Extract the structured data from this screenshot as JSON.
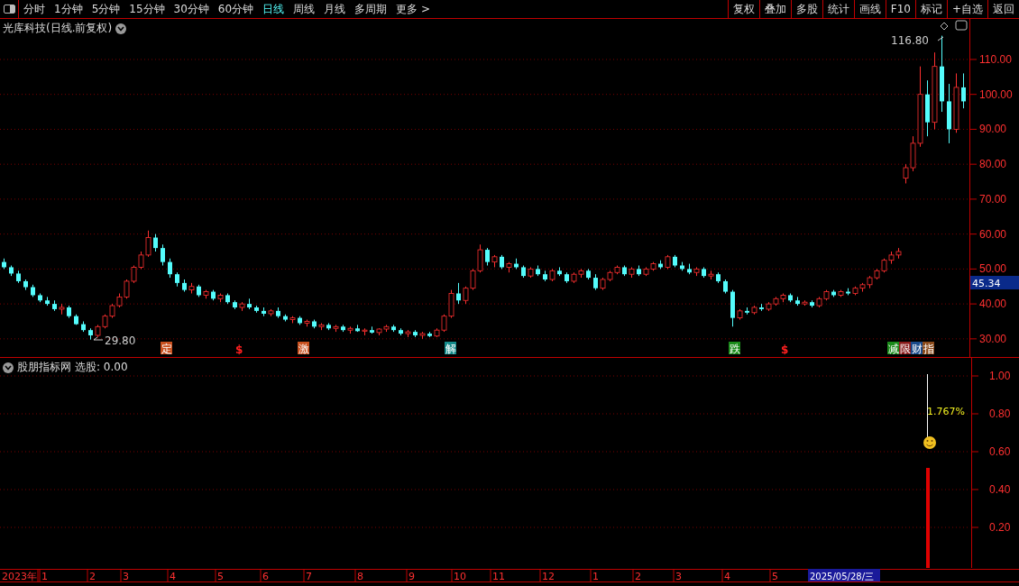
{
  "toolbar": {
    "periods": [
      {
        "label": "分时",
        "selected": false
      },
      {
        "label": "1分钟",
        "selected": false
      },
      {
        "label": "5分钟",
        "selected": false
      },
      {
        "label": "15分钟",
        "selected": false
      },
      {
        "label": "30分钟",
        "selected": false
      },
      {
        "label": "60分钟",
        "selected": false
      },
      {
        "label": "日线",
        "selected": true
      },
      {
        "label": "周线",
        "selected": false
      },
      {
        "label": "月线",
        "selected": false
      },
      {
        "label": "多周期",
        "selected": false
      },
      {
        "label": "更多 >",
        "selected": false
      }
    ],
    "actions": [
      "复权",
      "叠加",
      "多股",
      "统计",
      "画线",
      "F10",
      "标记",
      "+自选",
      "返回"
    ]
  },
  "main_chart": {
    "title": "光库科技(日线.前复权)",
    "chart_data": {
      "type": "candlestick",
      "grid": true,
      "ylim": [
        24.8,
        121.6
      ],
      "yticks": [
        {
          "value": 110,
          "label": "110.00"
        },
        {
          "value": 100,
          "label": "100.00"
        },
        {
          "value": 90,
          "label": "90.00"
        },
        {
          "value": 80,
          "label": "80.00"
        },
        {
          "value": 70,
          "label": "70.00"
        },
        {
          "value": 60,
          "label": "60.00"
        },
        {
          "value": 50,
          "label": "50.00"
        },
        {
          "value": 40,
          "label": "40.00"
        },
        {
          "value": 30,
          "label": "30.00"
        }
      ],
      "ohlc": [
        [
          52,
          53,
          50,
          50.5
        ],
        [
          50.5,
          51,
          48,
          48.7
        ],
        [
          48.7,
          49.5,
          46,
          46.5
        ],
        [
          46.5,
          47,
          44,
          44.8
        ],
        [
          44.8,
          45.5,
          42,
          42.5
        ],
        [
          42.5,
          43,
          40.5,
          41
        ],
        [
          41,
          42,
          39.5,
          40
        ],
        [
          40,
          41,
          38,
          38.5
        ],
        [
          38.5,
          40,
          37,
          39
        ],
        [
          39,
          39.5,
          36,
          36.5
        ],
        [
          36.5,
          37,
          34,
          34.2
        ],
        [
          34.2,
          35,
          32,
          32.5
        ],
        [
          32.5,
          33,
          29.8,
          31
        ],
        [
          31,
          34,
          30.5,
          33.5
        ],
        [
          33.5,
          37,
          33,
          36.5
        ],
        [
          36.5,
          40,
          36,
          39.5
        ],
        [
          39.5,
          43,
          39,
          42
        ],
        [
          42,
          47,
          41.5,
          46.5
        ],
        [
          46.5,
          51,
          46,
          50.5
        ],
        [
          50.5,
          55,
          50,
          54
        ],
        [
          54,
          61,
          53.5,
          59
        ],
        [
          59,
          60,
          55,
          56
        ],
        [
          56,
          57,
          51,
          52
        ],
        [
          52,
          53,
          47.5,
          48.5
        ],
        [
          48.5,
          49,
          45,
          46
        ],
        [
          46,
          47,
          43.5,
          44
        ],
        [
          44,
          46,
          43,
          45
        ],
        [
          45,
          45.5,
          42,
          42.5
        ],
        [
          42.5,
          44,
          41.5,
          43.5
        ],
        [
          43.5,
          44,
          41,
          41.5
        ],
        [
          41.5,
          43,
          40.5,
          42.5
        ],
        [
          42.5,
          43,
          40,
          40.5
        ],
        [
          40.5,
          41,
          38.5,
          39
        ],
        [
          39,
          40.5,
          38,
          40
        ],
        [
          40,
          41.5,
          38.5,
          39
        ],
        [
          39,
          39.5,
          37.5,
          38
        ],
        [
          38,
          39,
          36.5,
          37.2
        ],
        [
          37.2,
          38.5,
          36.5,
          38
        ],
        [
          38,
          39,
          36,
          36.5
        ],
        [
          36.5,
          37,
          35,
          35.5
        ],
        [
          35.5,
          36.5,
          34.5,
          36
        ],
        [
          36,
          36.5,
          34,
          34.5
        ],
        [
          34.5,
          35.5,
          33.5,
          35
        ],
        [
          35,
          35.5,
          33,
          33.5
        ],
        [
          33.5,
          34.5,
          32.5,
          34
        ],
        [
          34,
          34.5,
          32.5,
          33
        ],
        [
          33,
          34,
          32,
          33.5
        ],
        [
          33.5,
          34,
          32,
          32.5
        ],
        [
          32.5,
          33.5,
          31.5,
          33
        ],
        [
          33,
          34,
          32,
          32.2
        ],
        [
          32.2,
          33,
          31,
          32.5
        ],
        [
          32.5,
          33.5,
          31.5,
          31.8
        ],
        [
          31.8,
          33,
          31,
          32.8
        ],
        [
          32.8,
          34,
          32,
          33.5
        ],
        [
          33.5,
          34,
          32,
          32.5
        ],
        [
          32.5,
          33,
          31,
          31.5
        ],
        [
          31.5,
          32.5,
          30.5,
          32
        ],
        [
          32,
          32.5,
          30.5,
          31
        ],
        [
          31,
          32,
          30,
          31.5
        ],
        [
          31.5,
          32,
          30.5,
          30.8
        ],
        [
          30.8,
          33,
          30.5,
          32.5
        ],
        [
          32.5,
          37,
          32,
          36.5
        ],
        [
          36.5,
          44,
          36,
          43
        ],
        [
          43,
          46,
          40,
          41
        ],
        [
          41,
          45,
          40,
          44.5
        ],
        [
          44.5,
          50,
          44,
          49.5
        ],
        [
          49.5,
          57,
          49,
          55.5
        ],
        [
          55.5,
          56,
          51,
          52
        ],
        [
          52,
          54,
          50.5,
          53.5
        ],
        [
          53.5,
          54,
          50,
          50.5
        ],
        [
          50.5,
          52,
          49,
          51.5
        ],
        [
          51.5,
          53,
          50,
          50.5
        ],
        [
          50.5,
          51,
          47.5,
          48
        ],
        [
          48,
          50.5,
          47.5,
          50
        ],
        [
          50,
          51,
          48,
          48.5
        ],
        [
          48.5,
          49.5,
          46.5,
          47
        ],
        [
          47,
          50,
          46.5,
          49.5
        ],
        [
          49.5,
          50.5,
          48,
          48.5
        ],
        [
          48.5,
          49,
          46,
          46.5
        ],
        [
          46.5,
          49,
          46,
          48.5
        ],
        [
          48.5,
          50,
          47.5,
          49.5
        ],
        [
          49.5,
          50,
          47,
          47.5
        ],
        [
          47.5,
          48.5,
          44,
          44.5
        ],
        [
          44.5,
          47.5,
          44,
          47
        ],
        [
          47,
          49.5,
          46.5,
          49
        ],
        [
          49,
          51,
          48.5,
          50.5
        ],
        [
          50.5,
          51,
          48,
          48.5
        ],
        [
          48.5,
          50.5,
          47.5,
          50
        ],
        [
          50,
          51,
          48,
          48.5
        ],
        [
          48.5,
          50.5,
          48,
          50
        ],
        [
          50,
          52,
          49.5,
          51.5
        ],
        [
          51.5,
          52.5,
          50,
          50.5
        ],
        [
          50.5,
          54,
          50,
          53.5
        ],
        [
          53.5,
          54,
          50.5,
          51
        ],
        [
          51,
          52,
          49.5,
          50
        ],
        [
          50,
          51.5,
          48.5,
          49
        ],
        [
          49,
          50.5,
          48,
          50
        ],
        [
          50,
          50.5,
          47.5,
          48
        ],
        [
          48,
          49.5,
          47,
          48.5
        ],
        [
          48.5,
          49,
          46,
          46.5
        ],
        [
          46.5,
          47,
          43,
          43.5
        ],
        [
          43.5,
          44,
          33.5,
          36
        ],
        [
          36,
          38.5,
          35.5,
          38
        ],
        [
          38,
          39,
          37,
          37.5
        ],
        [
          37.5,
          39.5,
          37,
          39
        ],
        [
          39,
          40,
          38,
          38.5
        ],
        [
          38.5,
          40.5,
          38,
          40
        ],
        [
          40,
          42,
          39.5,
          41.5
        ],
        [
          41.5,
          43,
          40.5,
          42.5
        ],
        [
          42.5,
          43,
          40.5,
          41
        ],
        [
          41,
          42,
          39.5,
          40
        ],
        [
          40,
          41,
          39.5,
          40.5
        ],
        [
          40.5,
          41,
          39,
          39.5
        ],
        [
          39.5,
          42,
          39,
          41.5
        ],
        [
          41.5,
          44,
          41,
          43.5
        ],
        [
          43.5,
          44,
          42,
          42.5
        ],
        [
          42.5,
          44,
          42,
          43.5
        ],
        [
          43.5,
          44.5,
          42.5,
          43
        ],
        [
          43,
          45,
          42.5,
          44.5
        ],
        [
          44.5,
          46,
          43.5,
          45.5
        ],
        [
          45.5,
          48,
          44.5,
          47.5
        ],
        [
          47.5,
          50,
          47,
          49.5
        ],
        [
          49.5,
          53,
          49,
          52.5
        ],
        [
          52.5,
          55,
          51.5,
          54
        ],
        [
          54,
          56,
          53,
          55
        ],
        [
          76,
          80,
          74.5,
          79
        ],
        [
          79,
          88,
          78,
          86
        ],
        [
          86,
          108,
          85,
          100
        ],
        [
          100,
          104,
          88,
          92
        ],
        [
          92,
          112,
          90,
          108
        ],
        [
          108,
          116.8,
          95,
          98
        ],
        [
          98,
          103,
          86,
          90
        ],
        [
          90,
          106,
          89,
          102
        ],
        [
          102,
          106,
          96,
          98
        ]
      ]
    },
    "high_label": "116.80",
    "low_label": "29.80",
    "last_price": "45.34",
    "signals": [
      {
        "text": "定",
        "kind": "tag",
        "color": "#c8501e"
      },
      {
        "text": "$",
        "kind": "plain",
        "color": "#ff2020"
      },
      {
        "text": "激",
        "kind": "tag",
        "color": "#c8501e"
      },
      {
        "text": "解",
        "kind": "tag",
        "color": "#138a8a"
      },
      {
        "text": "跌",
        "kind": "tag",
        "color": "#1a8a1a"
      },
      {
        "text": "$",
        "kind": "plain",
        "color": "#ff2020"
      },
      {
        "text": "减",
        "kind": "tag",
        "color": "#1a8a1a"
      },
      {
        "text": "限",
        "kind": "tag",
        "color": "#8a1a1a"
      },
      {
        "text": "财",
        "kind": "tag",
        "color": "#1a4a8a"
      },
      {
        "text": "指",
        "kind": "tag",
        "color": "#8a4a1a"
      }
    ]
  },
  "indicator": {
    "name": "股朋指标网",
    "reading": "选股: 0.00",
    "y_ticks": [
      "1.00",
      "0.80",
      "0.60",
      "0.40",
      "0.20"
    ],
    "value_label": "1.767%"
  },
  "time_axis": {
    "labels": [
      "2023年",
      "1",
      "2",
      "3",
      "4",
      "5",
      "6",
      "7",
      "8",
      "9",
      "10",
      "11",
      "12",
      "1",
      "2",
      "3",
      "4",
      "5"
    ],
    "cursor_date": "2025/05/28/三"
  }
}
